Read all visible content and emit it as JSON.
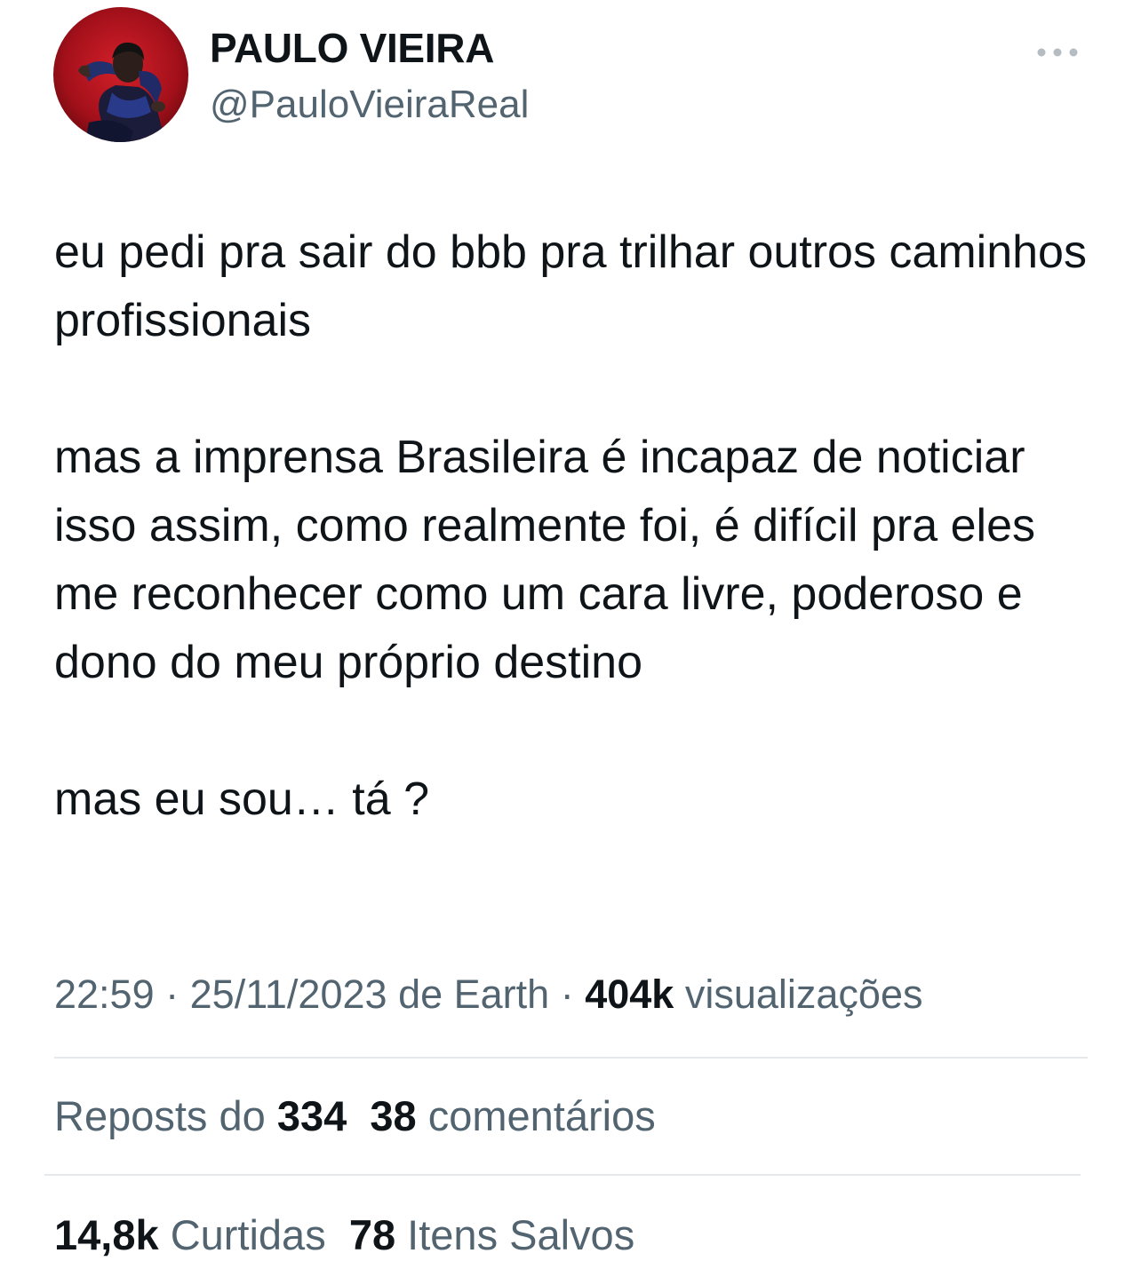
{
  "author": {
    "name": "PAULO VIEIRA",
    "handle": "@PauloVieiraReal"
  },
  "more_icon": "more-horizontal-icon",
  "tweet": {
    "paragraphs": [
      "eu pedi pra sair do bbb pra trilhar outros caminhos profissionais",
      "mas a imprensa Brasileira é incapaz de noticiar isso assim, como realmente foi, é difícil pra eles me reconhecer como um cara livre, poderoso e dono do meu próprio destino",
      "mas eu sou… tá ?"
    ]
  },
  "meta": {
    "time": "22:59",
    "separator": "·",
    "date": "25/11/2023",
    "source": "de Earth",
    "views_count": "404k",
    "views_label": "visualizações"
  },
  "stats": {
    "reposts_label": "Reposts do",
    "reposts_count": "334",
    "comments_count": "38",
    "comments_label": "comentários",
    "likes_count": "14,8k",
    "likes_label": "Curtidas",
    "bookmarks_count": "78",
    "bookmarks_label": "Itens Salvos"
  },
  "colors": {
    "text_primary": "#0f1419",
    "text_secondary": "#536471",
    "divider": "#e6e9eb",
    "avatar_background": "#b3121b"
  }
}
